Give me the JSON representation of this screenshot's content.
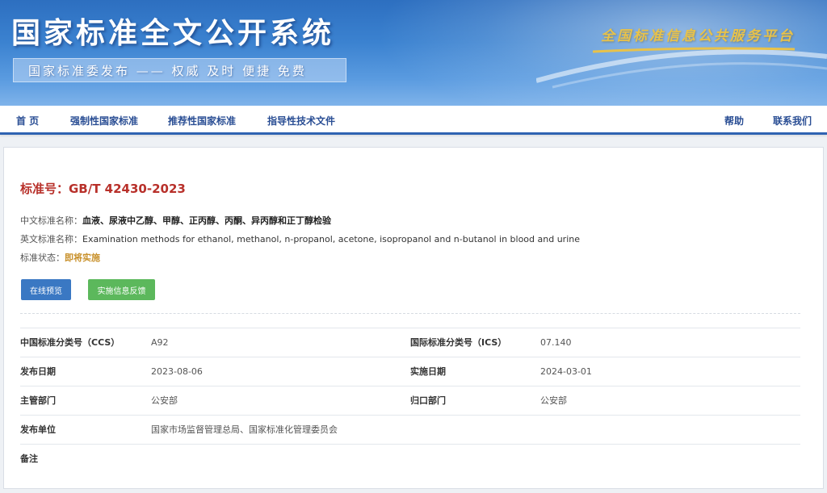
{
  "header": {
    "title": "国家标准全文公开系统",
    "slogan": "国家标准委发布 —— 权威 及时 便捷 免费",
    "platform": "全国标准信息公共服务平台"
  },
  "nav": {
    "home": "首 页",
    "mandatory": "强制性国家标准",
    "recommended": "推荐性国家标准",
    "guidance": "指导性技术文件",
    "help": "帮助",
    "contact": "联系我们"
  },
  "standard": {
    "number": "标准号：GB/T 42430-2023",
    "cn_name_label": "中文标准名称：",
    "cn_name": "血液、尿液中乙醇、甲醇、正丙醇、丙酮、异丙醇和正丁醇检验",
    "en_name_label": "英文标准名称：",
    "en_name": "Examination methods for ethanol, methanol, n-propanol, acetone, isopropanol and n-butanol in blood and urine",
    "status_label": "标准状态：",
    "status": "即将实施"
  },
  "buttons": {
    "preview": "在线预览",
    "feedback": "实施信息反馈"
  },
  "details": {
    "ccs_label": "中国标准分类号（CCS）",
    "ccs": "A92",
    "ics_label": "国际标准分类号（ICS）",
    "ics": "07.140",
    "publish_date_label": "发布日期",
    "publish_date": "2023-08-06",
    "impl_date_label": "实施日期",
    "impl_date": "2024-03-01",
    "dept_label": "主管部门",
    "dept": "公安部",
    "owner_label": "归口部门",
    "owner": "公安部",
    "publisher_label": "发布单位",
    "publisher": "国家市场监督管理总局、国家标准化管理委员会",
    "remark_label": "备注"
  },
  "colors": {
    "nav_link": "#2a4e94",
    "standard_number": "#b8302a",
    "status": "#c8902a",
    "preview_button": "#3a78c3",
    "feedback_button": "#5cb85c"
  }
}
